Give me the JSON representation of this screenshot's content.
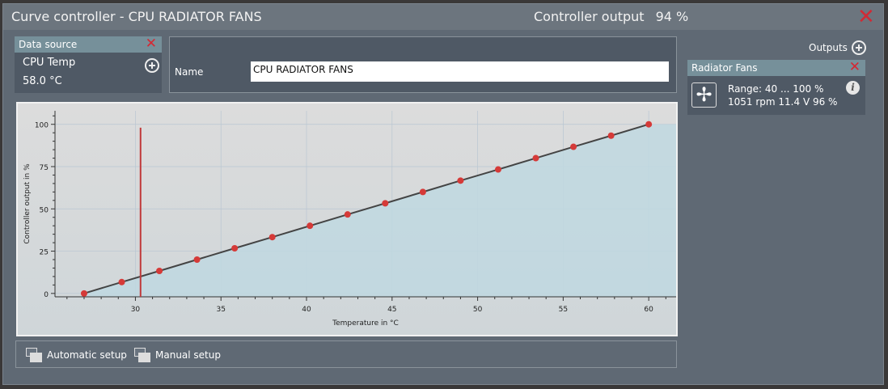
{
  "header": {
    "title": "Curve controller  -  CPU RADIATOR FANS",
    "output_label": "Controller output",
    "output_value": "94 %"
  },
  "data_source": {
    "title": "Data source",
    "sensor": "CPU Temp",
    "value": "58.0 °C"
  },
  "name_field": {
    "label": "Name",
    "value": "CPU RADIATOR FANS"
  },
  "outputs": {
    "label": "Outputs",
    "items": [
      {
        "title": "Radiator Fans",
        "range": "Range:  40 ... 100  %",
        "status": "1051 rpm  11.4 V  96 %"
      }
    ]
  },
  "buttons": {
    "automatic": "Automatic setup",
    "manual": "Manual setup"
  },
  "colors": {
    "accent_red": "#d12a35",
    "point": "#d53a38",
    "fill": "#bfd8e0"
  },
  "chart_data": {
    "type": "line",
    "xlabel": "Temperature in °C",
    "ylabel": "Controller output in %",
    "xlim": [
      25.3,
      61.6
    ],
    "ylim": [
      -2,
      108
    ],
    "xticks": [
      30,
      35,
      40,
      45,
      50,
      55,
      60
    ],
    "yticks": [
      0,
      25,
      50,
      75,
      100
    ],
    "x": [
      27,
      29.2,
      31.4,
      33.6,
      35.8,
      38,
      40.2,
      42.4,
      44.6,
      46.8,
      49,
      51.2,
      53.4,
      55.6,
      57.8,
      60
    ],
    "y": [
      0,
      6.7,
      13.3,
      20,
      26.7,
      33.3,
      40,
      46.7,
      53.3,
      60,
      66.7,
      73.3,
      80,
      86.7,
      93.3,
      100
    ],
    "current_temperature": 30.3,
    "grid": true
  }
}
